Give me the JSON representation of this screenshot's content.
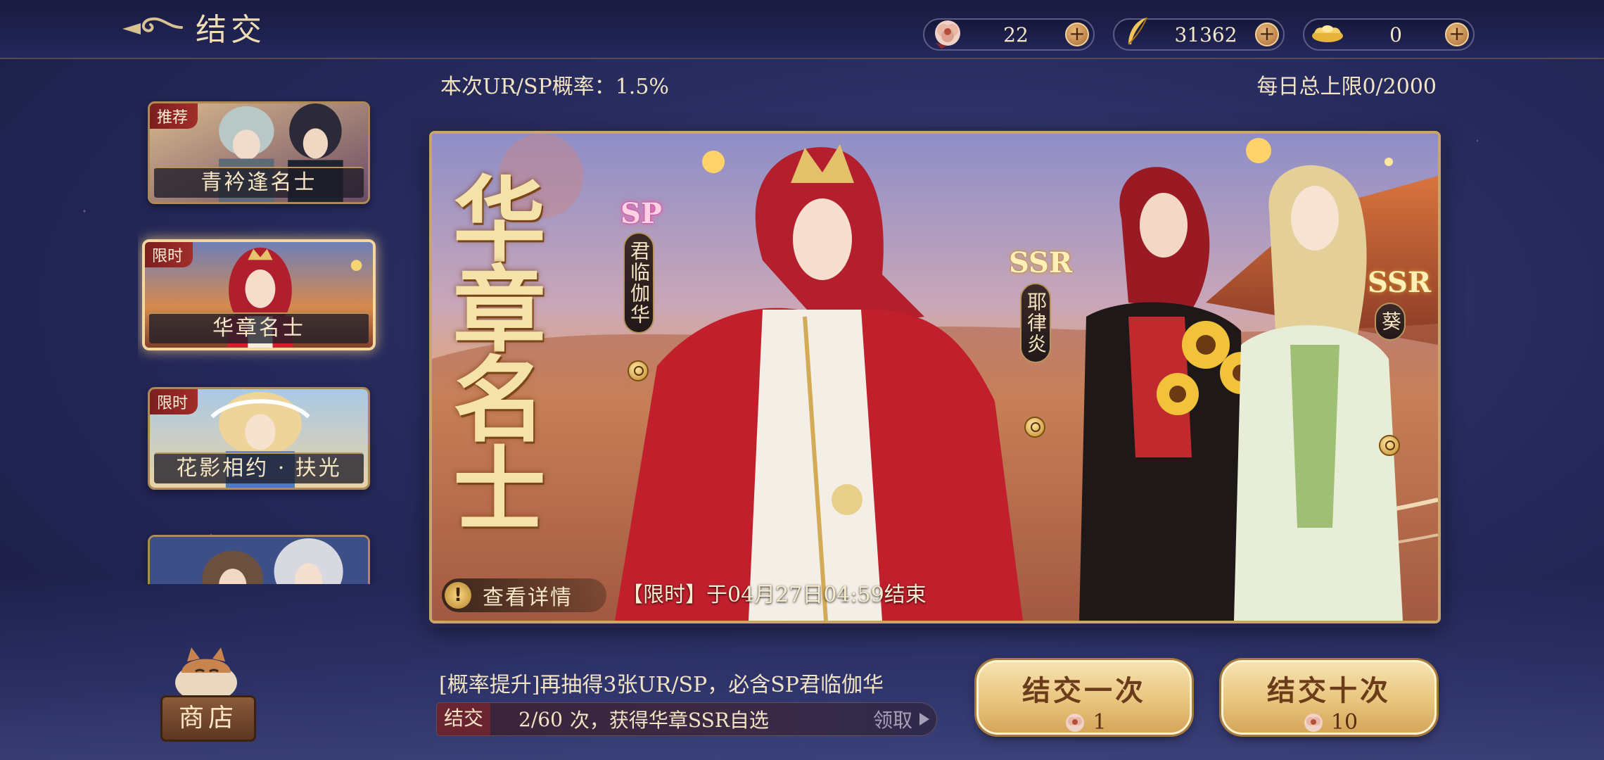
{
  "header": {
    "title": "结交",
    "currencies": [
      {
        "icon": "peony-token-icon",
        "value": "22"
      },
      {
        "icon": "feather-icon",
        "value": "31362"
      },
      {
        "icon": "gold-ingot-icon",
        "value": "0"
      }
    ],
    "plus_label": "+"
  },
  "info": {
    "rate": "本次UR/SP概率：1.5%",
    "daily_limit": "每日总上限0/2000"
  },
  "pools": [
    {
      "tag": "推荐",
      "name": "青衿逢名士"
    },
    {
      "tag": "限时",
      "name": "华章名士"
    },
    {
      "tag": "限时",
      "name": "花影相约 · 扶光"
    },
    {
      "tag": "",
      "name": ""
    }
  ],
  "shop": {
    "label": "商店"
  },
  "banner": {
    "title": "华章名士",
    "characters": [
      {
        "rarity": "SP",
        "name": "君临伽华"
      },
      {
        "rarity": "SSR",
        "name": "耶律炎"
      },
      {
        "rarity": "SSR",
        "name": "葵"
      }
    ],
    "detail_label": "查看详情",
    "detail_icon_glyph": "!",
    "end_time": "【限时】于04月27日04:59结束"
  },
  "bottom": {
    "boost_text": "[概率提升]再抽得3张UR/SP，必含SP君临伽华",
    "progress": {
      "tag": "结交",
      "count": "2/60",
      "text": "次，获得华章SSR自选",
      "claim": "领取"
    },
    "pull_once": {
      "label": "结交一次",
      "cost": "1"
    },
    "pull_ten": {
      "label": "结交十次",
      "cost": "10"
    }
  },
  "colors": {
    "gold": "#c9a56a",
    "accent_red": "#a12e2a",
    "bg": "#262a5c"
  }
}
